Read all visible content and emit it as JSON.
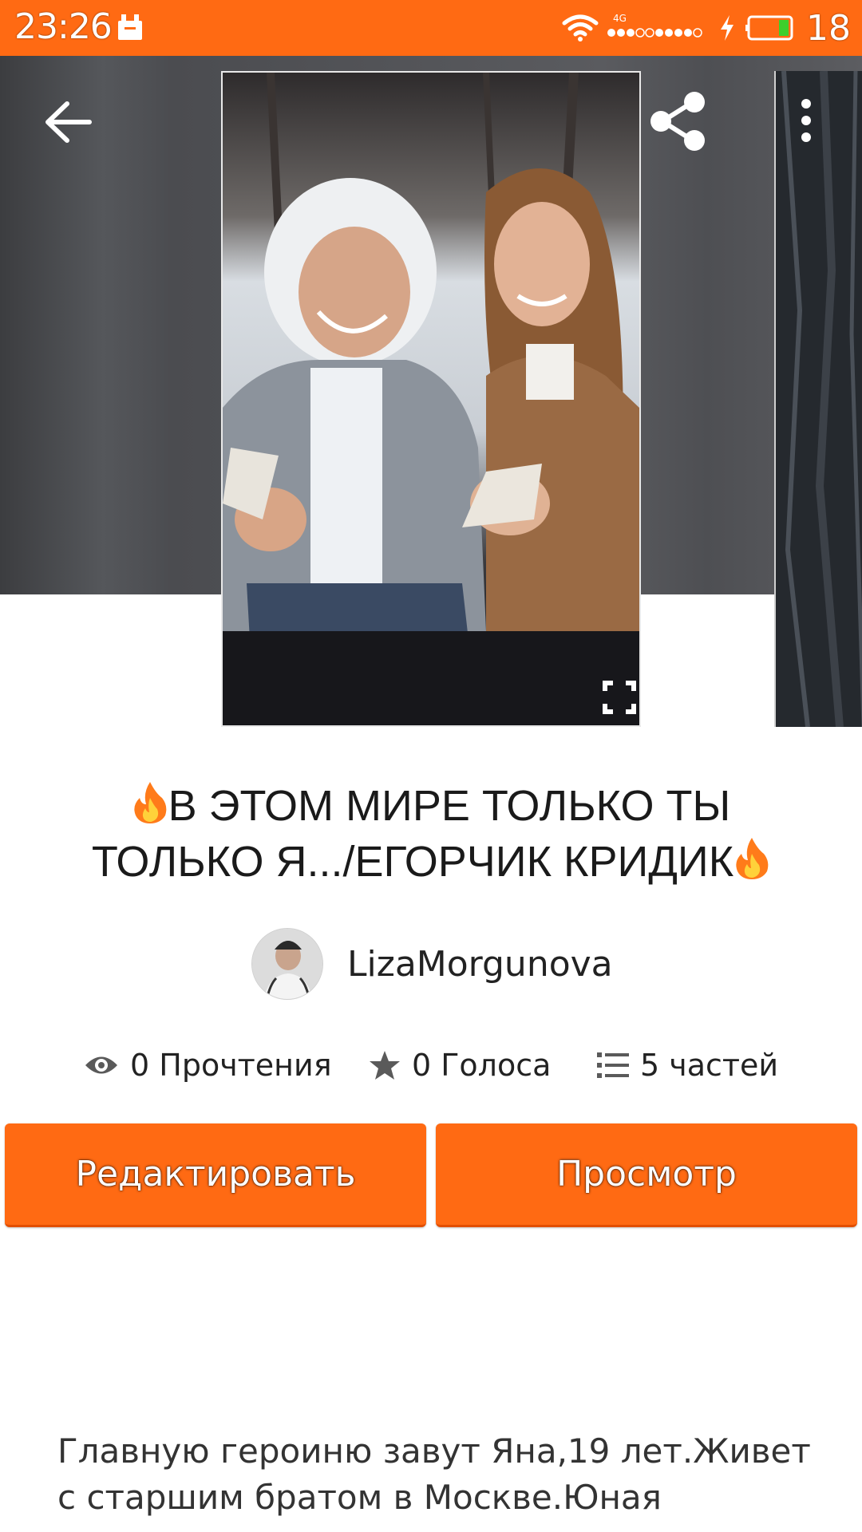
{
  "status_bar": {
    "time": "23:26",
    "network": "4G",
    "battery": "18",
    "color": "#ff6a13"
  },
  "header": {
    "icons": [
      "back-arrow-icon",
      "share-icon",
      "more-vertical-icon",
      "fullscreen-icon"
    ]
  },
  "story": {
    "title_line1": "В ЭТОМ МИРЕ ТОЛЬКО ТЫ",
    "title_line2": "ТОЛЬКО Я.../ЕГОРЧИК КРИДИК",
    "author": "LizaMorgunova",
    "stats": {
      "reads": "0 Прочтения",
      "votes": "0 Голоса",
      "parts": "5 частей"
    },
    "description": "Главную героиню завут Яна,19 лет.Живет с старшим братом в Москве.Юная девушка в"
  },
  "actions": {
    "edit_label": "Редактировать",
    "view_label": "Просмотр"
  },
  "colors": {
    "accent": "#ff6a13",
    "text": "#1a1a1a"
  }
}
